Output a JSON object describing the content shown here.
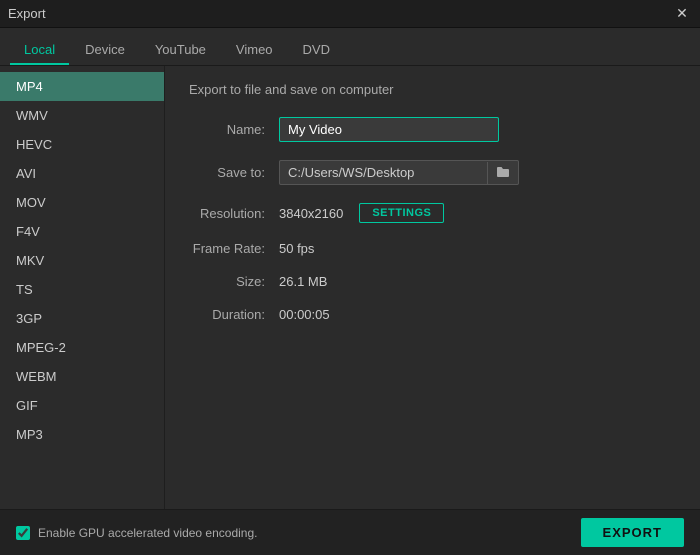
{
  "titlebar": {
    "title": "Export",
    "close_label": "✕"
  },
  "tabs": [
    {
      "id": "local",
      "label": "Local",
      "active": true
    },
    {
      "id": "device",
      "label": "Device",
      "active": false
    },
    {
      "id": "youtube",
      "label": "YouTube",
      "active": false
    },
    {
      "id": "vimeo",
      "label": "Vimeo",
      "active": false
    },
    {
      "id": "dvd",
      "label": "DVD",
      "active": false
    }
  ],
  "sidebar": {
    "items": [
      {
        "id": "mp4",
        "label": "MP4",
        "active": true
      },
      {
        "id": "wmv",
        "label": "WMV",
        "active": false
      },
      {
        "id": "hevc",
        "label": "HEVC",
        "active": false
      },
      {
        "id": "avi",
        "label": "AVI",
        "active": false
      },
      {
        "id": "mov",
        "label": "MOV",
        "active": false
      },
      {
        "id": "f4v",
        "label": "F4V",
        "active": false
      },
      {
        "id": "mkv",
        "label": "MKV",
        "active": false
      },
      {
        "id": "ts",
        "label": "TS",
        "active": false
      },
      {
        "id": "3gp",
        "label": "3GP",
        "active": false
      },
      {
        "id": "mpeg2",
        "label": "MPEG-2",
        "active": false
      },
      {
        "id": "webm",
        "label": "WEBM",
        "active": false
      },
      {
        "id": "gif",
        "label": "GIF",
        "active": false
      },
      {
        "id": "mp3",
        "label": "MP3",
        "active": false
      }
    ]
  },
  "content": {
    "export_title": "Export to file and save on computer",
    "name_label": "Name:",
    "name_value": "My Video",
    "save_to_label": "Save to:",
    "save_to_path": "C:/Users/WS/Desktop",
    "resolution_label": "Resolution:",
    "resolution_value": "3840x2160",
    "settings_label": "SETTINGS",
    "frame_rate_label": "Frame Rate:",
    "frame_rate_value": "50 fps",
    "size_label": "Size:",
    "size_value": "26.1 MB",
    "duration_label": "Duration:",
    "duration_value": "00:00:05"
  },
  "bottombar": {
    "gpu_label": "Enable GPU accelerated video encoding.",
    "export_label": "EXPORT",
    "folder_icon": "🗁"
  }
}
